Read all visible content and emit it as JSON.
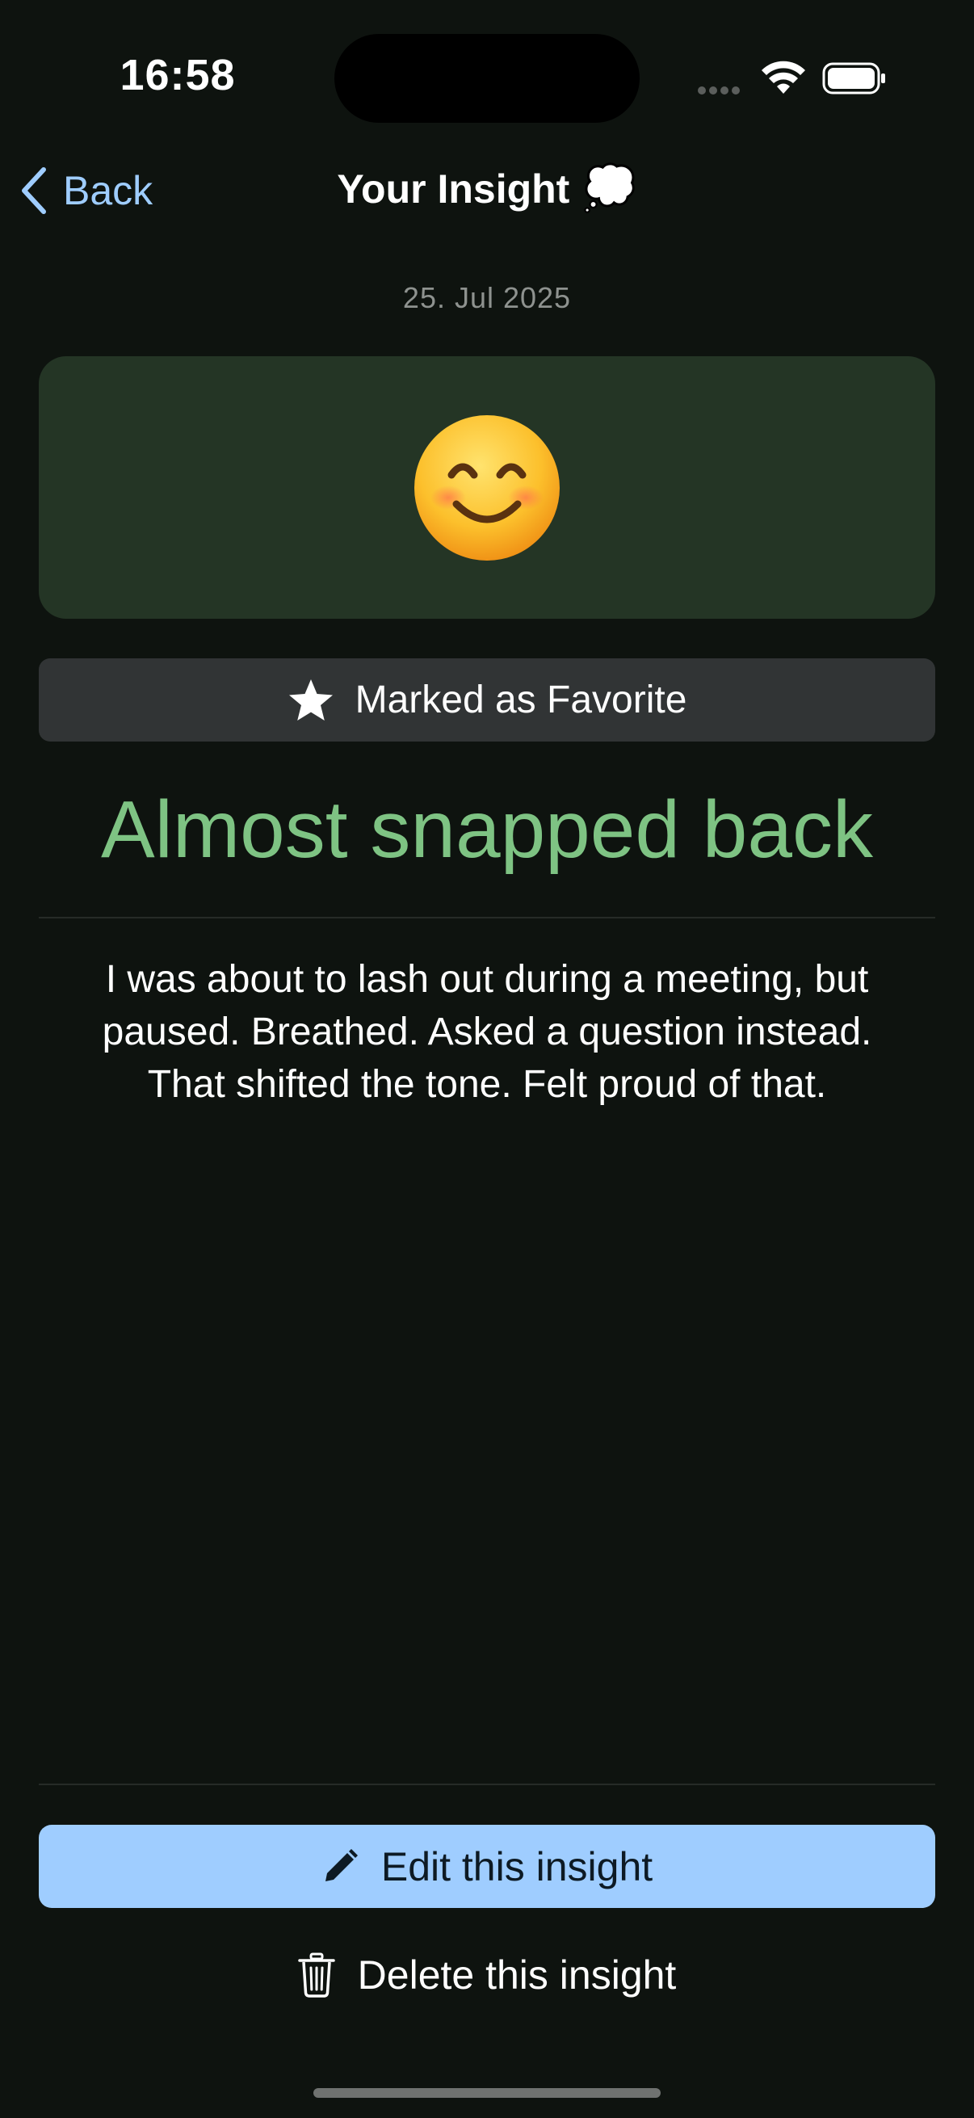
{
  "status_bar": {
    "time": "16:58"
  },
  "nav": {
    "back_label": "Back",
    "title": "Your Insight",
    "title_emoji": "💭"
  },
  "entry": {
    "date": "25. Jul 2025",
    "mood_icon": "smiling-face-icon",
    "favorite_label": "Marked as Favorite",
    "title": "Almost snapped back",
    "body_lines": [
      "I was about to lash out during a meeting, but",
      "paused. Breathed. Asked a question instead.",
      "That shifted the tone. Felt proud of that."
    ]
  },
  "actions": {
    "edit_label": "Edit this insight",
    "delete_label": "Delete this insight"
  },
  "colors": {
    "background": "#0e130f",
    "accent_blue": "#9fcdff",
    "title_green": "#7ec383",
    "mood_card": "#243525"
  }
}
